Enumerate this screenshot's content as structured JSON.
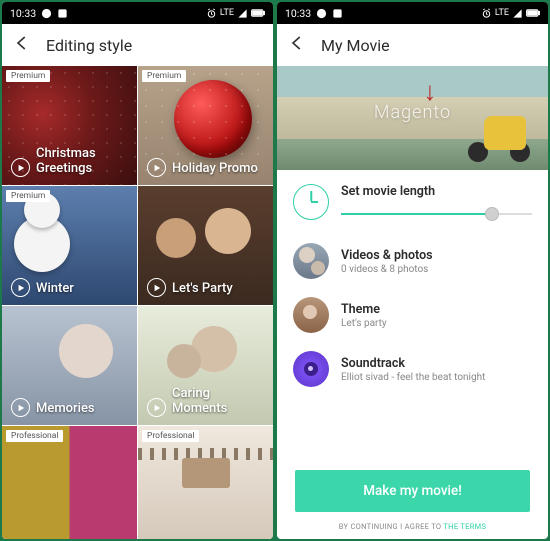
{
  "statusbar": {
    "time": "10:33",
    "network": "LTE"
  },
  "left": {
    "title": "Editing style",
    "badges": {
      "premium": "Premium",
      "professional": "Professional"
    },
    "tiles": [
      {
        "label": "Christmas Greetings",
        "badge": "premium"
      },
      {
        "label": "Holiday Promo",
        "badge": "premium"
      },
      {
        "label": "Winter",
        "badge": "premium"
      },
      {
        "label": "Let's Party"
      },
      {
        "label": "Memories"
      },
      {
        "label": "Caring Moments"
      },
      {
        "label": "",
        "badge": "professional"
      },
      {
        "label": "",
        "badge": "professional"
      }
    ]
  },
  "right": {
    "title": "My Movie",
    "hero_caption": "Magento",
    "length": {
      "title": "Set movie length",
      "value_pct": 79
    },
    "media": {
      "title": "Videos & photos",
      "sub": "0 videos  & 8 photos"
    },
    "theme": {
      "title": "Theme",
      "sub": "Let's party"
    },
    "sound": {
      "title": "Soundtrack",
      "sub": "Elliot sivad - feel the beat tonight"
    },
    "cta": "Make my movie!",
    "terms_prefix": "BY CONTINUING I AGREE TO ",
    "terms_link": "THE TERMS"
  }
}
